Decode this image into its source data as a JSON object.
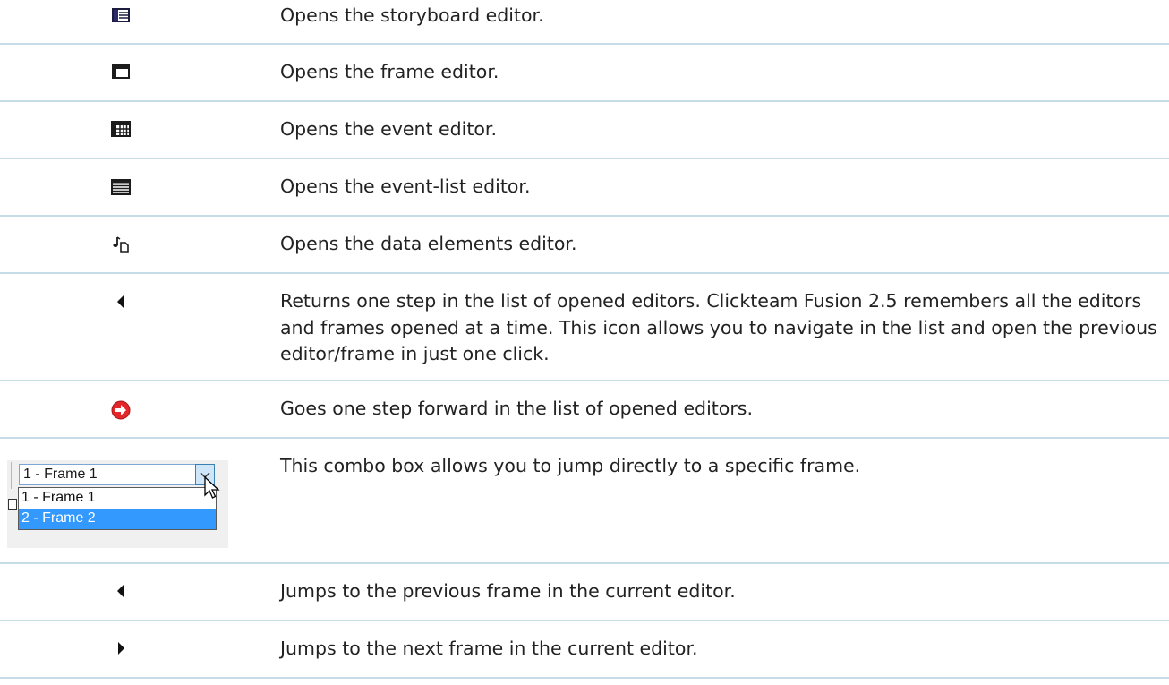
{
  "rows": [
    {
      "icon": "storyboard-editor-icon",
      "text": "Opens the storyboard editor."
    },
    {
      "icon": "frame-editor-icon",
      "text": "Opens the frame editor."
    },
    {
      "icon": "event-editor-icon",
      "text": "Opens the event editor."
    },
    {
      "icon": "event-list-editor-icon",
      "text": "Opens the event-list editor."
    },
    {
      "icon": "data-elements-editor-icon",
      "text": "Opens the data elements editor."
    },
    {
      "icon": "back-arrow-icon",
      "text": "Returns one step in the list of opened editors. Clickteam Fusion 2.5 remembers all the editors and frames opened at a time. This icon allows you to navigate in the list and open the previous editor/frame in just one click."
    },
    {
      "icon": "forward-red-circle-icon",
      "text": "Goes one step forward in the list of opened editors."
    },
    {
      "icon": "frame-combo-box",
      "text": "This combo box allows you to jump directly to a specific frame."
    },
    {
      "icon": "previous-frame-icon",
      "text": "Jumps to the previous frame in the current editor."
    },
    {
      "icon": "next-frame-icon",
      "text": "Jumps to the next frame in the current editor."
    }
  ],
  "combo": {
    "selected": "1 - Frame 1",
    "options": [
      "1 - Frame 1",
      "2 - Frame 2"
    ]
  },
  "colors": {
    "row_border": "#c6dde7",
    "selection": "#3399ff",
    "forward_icon": "#e3262a"
  }
}
